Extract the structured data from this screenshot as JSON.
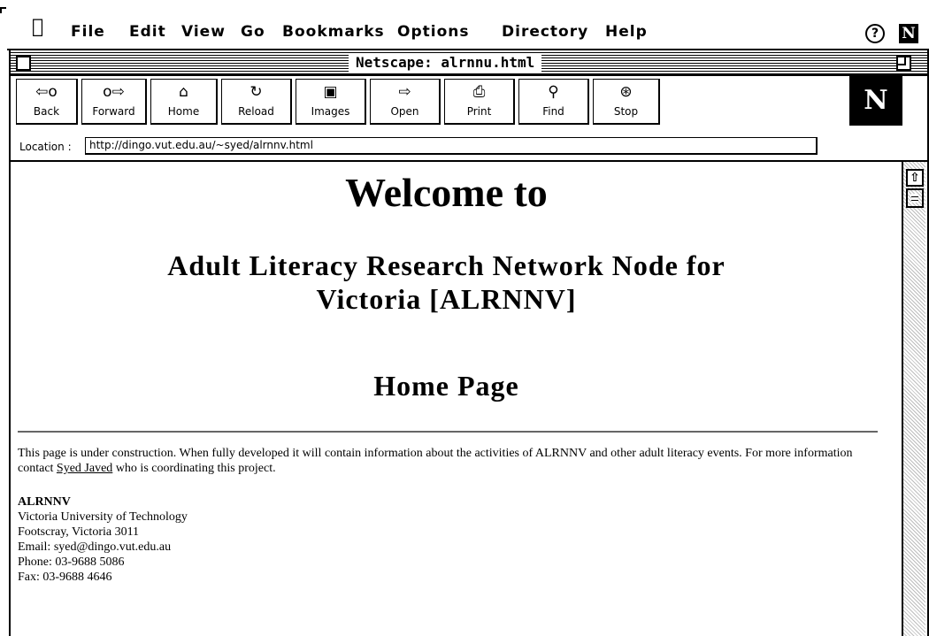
{
  "menubar": {
    "apple_icon": "apple-icon",
    "items": [
      {
        "label": "File"
      },
      {
        "label": "Edit"
      },
      {
        "label": "View"
      },
      {
        "label": "Go"
      },
      {
        "label": "Bookmarks"
      },
      {
        "label": "Options"
      },
      {
        "label": "Directory"
      },
      {
        "label": "Help"
      }
    ],
    "help_icon_glyph": "?",
    "app_icon_glyph": "N"
  },
  "window": {
    "title": "Netscape: alrnnu.html"
  },
  "toolbar": {
    "buttons": [
      {
        "label": "Back",
        "icon": "back-arrow-icon",
        "glyph": "⇦o"
      },
      {
        "label": "Forward",
        "icon": "forward-arrow-icon",
        "glyph": "o⇨"
      },
      {
        "label": "Home",
        "icon": "house-icon",
        "glyph": "⌂"
      },
      {
        "label": "Reload",
        "icon": "reload-icon",
        "glyph": "↻"
      },
      {
        "label": "Images",
        "icon": "images-icon",
        "glyph": "▣"
      },
      {
        "label": "Open",
        "icon": "open-icon",
        "glyph": "⇨"
      },
      {
        "label": "Print",
        "icon": "printer-icon",
        "glyph": "⎙"
      },
      {
        "label": "Find",
        "icon": "binoculars-icon",
        "glyph": "⚲"
      },
      {
        "label": "Stop",
        "icon": "stop-icon",
        "glyph": "⊛"
      }
    ],
    "logo_glyph": "N"
  },
  "location": {
    "label": "Location :",
    "url": "http://dingo.vut.edu.au/~syed/alrnnv.html"
  },
  "page": {
    "heading": "Welcome to",
    "org_line1": "Adult Literacy Research Network Node for",
    "org_line2": "Victoria [ALRNNV]",
    "subheading": "Home Page",
    "intro_before": "This page is under construction. When fully developed it will contain information about the activities of ALRNNV and other adult literacy events. For more information contact ",
    "contact_link": "Syed Javed",
    "intro_after": " who is coordinating this project.",
    "contact": {
      "name": "ALRNNV",
      "line1": "Victoria University of Technology",
      "line2": "Footscray, Victoria 3011",
      "line3": "Email: syed@dingo.vut.edu.au",
      "line4": "Phone: 03-9688 5086",
      "line5": "Fax: 03-9688 4646"
    }
  },
  "scrollbar": {
    "up_glyph": "⇧"
  }
}
